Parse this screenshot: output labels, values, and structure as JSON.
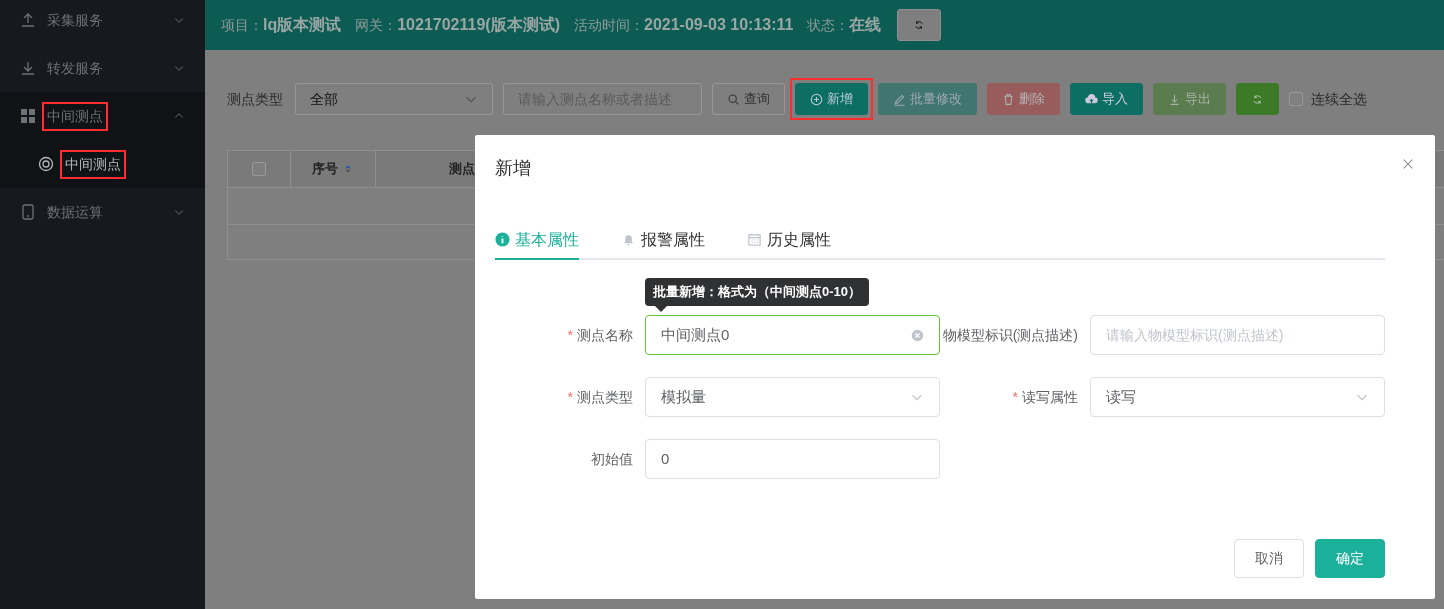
{
  "sidebar": {
    "items": [
      {
        "label": "采集服务",
        "expanded": false,
        "highlighted": false
      },
      {
        "label": "转发服务",
        "expanded": false,
        "highlighted": false
      },
      {
        "label": "中间测点",
        "expanded": true,
        "highlighted": true,
        "children": [
          {
            "label": "中间测点",
            "selected": true,
            "highlighted": true
          }
        ]
      },
      {
        "label": "数据运算",
        "expanded": false,
        "highlighted": false
      }
    ]
  },
  "header": {
    "fields": [
      {
        "label": "项目：",
        "value": "lq版本测试"
      },
      {
        "label": "网关：",
        "value": "1021702119(版本测试)"
      },
      {
        "label": "活动时间：",
        "value": "2021-09-03 10:13:11"
      },
      {
        "label": "状态：",
        "value": "在线"
      }
    ]
  },
  "toolbar": {
    "type_label": "测点类型",
    "type_select": {
      "value": "全部"
    },
    "search": {
      "placeholder": "请输入测点名称或者描述"
    },
    "buttons": [
      {
        "kind": "query",
        "label": "查询",
        "disabled": false,
        "highlighted": false
      },
      {
        "kind": "add",
        "label": "新增",
        "disabled": false,
        "highlighted": true
      },
      {
        "kind": "edit",
        "label": "批量修改",
        "disabled": true,
        "highlighted": false
      },
      {
        "kind": "delete",
        "label": "删除",
        "disabled": true,
        "highlighted": false
      },
      {
        "kind": "import",
        "label": "导入",
        "disabled": false,
        "highlighted": false
      },
      {
        "kind": "export",
        "label": "导出",
        "disabled": true,
        "highlighted": false
      },
      {
        "kind": "refresh",
        "disabled": false,
        "highlighted": false
      }
    ],
    "select_all": {
      "label": "连续全选",
      "checked": false
    }
  },
  "table": {
    "header_checkbox": {
      "checked": false
    },
    "columns": [
      "序号",
      "测点"
    ]
  },
  "dialog": {
    "title": "新增",
    "tabs": [
      {
        "label": "基本属性",
        "selected": true
      },
      {
        "label": "报警属性",
        "selected": false
      },
      {
        "label": "历史属性",
        "selected": false
      }
    ],
    "tooltip": "批量新增：格式为（中间测点0-10）",
    "fields": [
      {
        "kind": "text",
        "required_mark": "*",
        "label": "测点名称",
        "value": "中间测点0",
        "focused": true
      },
      {
        "kind": "text",
        "label": "物模型标识(测点描述)",
        "placeholder": "请输入物模型标识(测点描述)",
        "focused": false
      },
      {
        "kind": "select",
        "required_mark": "*",
        "label": "测点类型",
        "value": "模拟量",
        "focused": false
      },
      {
        "kind": "select",
        "required_mark": "*",
        "label": "读写属性",
        "value": "读写",
        "focused": false
      },
      {
        "kind": "text",
        "label": "初始值",
        "value": "0",
        "focused": false
      }
    ],
    "buttons": [
      {
        "kind": "cancel",
        "label": "取消"
      },
      {
        "kind": "confirm",
        "label": "确定"
      }
    ]
  }
}
